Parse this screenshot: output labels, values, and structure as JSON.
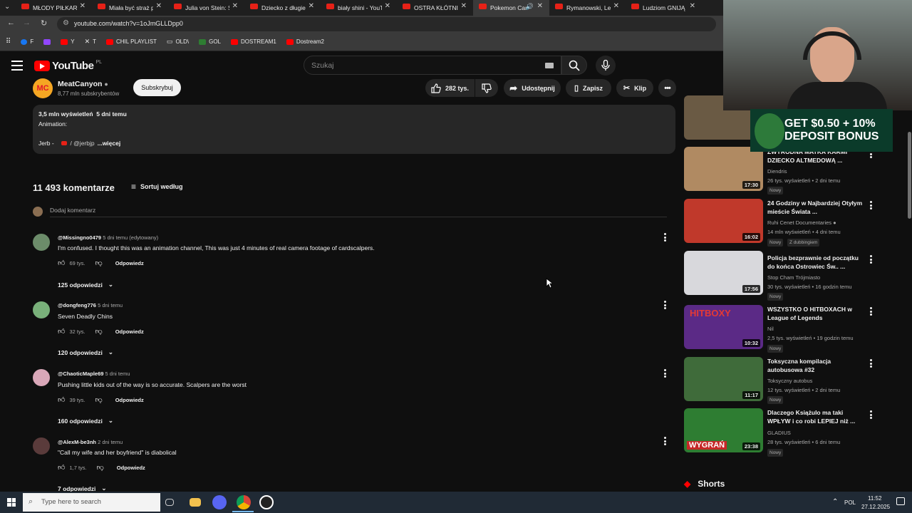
{
  "browser": {
    "tabs": [
      {
        "title": "MŁODY PIŁKARZ",
        "active": false
      },
      {
        "title": "Miała być straż p",
        "active": false
      },
      {
        "title": "Julia von Stein: Św",
        "active": false
      },
      {
        "title": "Dziecko z długiem",
        "active": false
      },
      {
        "title": "biały shini - YouTu",
        "active": false
      },
      {
        "title": "OSTRA KŁÓTNIA",
        "active": false
      },
      {
        "title": "Pokemon Car",
        "active": true
      },
      {
        "title": "Rymanowski, Lew",
        "active": false
      },
      {
        "title": "Ludziom GNIJĄ M",
        "active": false
      }
    ],
    "url": "youtube.com/watch?v=1oJmGLLDpp0",
    "bookmarks": [
      {
        "label": "F",
        "color": "#1877f2"
      },
      {
        "label": "",
        "color": "#9146ff"
      },
      {
        "label": "Y",
        "color": "#ff0000"
      },
      {
        "label": "T",
        "color": "#ffffff"
      },
      {
        "label": "CHIL PLAYLIST",
        "color": "#ff0000"
      },
      {
        "label": "OLD\\",
        "color": "#cccccc"
      },
      {
        "label": "GOL",
        "color": "#2e7d32"
      },
      {
        "label": "DOSTREAM1",
        "color": "#ff0000"
      },
      {
        "label": "Dostream2",
        "color": "#ff0000"
      }
    ]
  },
  "youtube": {
    "logo_text": "YouTube",
    "logo_region": "PL",
    "search_placeholder": "Szukaj",
    "channel": {
      "avatar_text": "MC",
      "name": "MeatCanyon",
      "subs": "8,77 mln subskrybentów"
    },
    "subscribe_label": "Subskrybuj",
    "likes": "282 tys.",
    "share_label": "Udostępnij",
    "save_label": "Zapisz",
    "clip_label": "Klip",
    "description": {
      "stats": "3,5 mln wyświetleń  5 dni temu",
      "line1": "Animation:",
      "line2a": "Jerb - ",
      "line2b": " / @jerbjp",
      "more": "...więcej"
    },
    "comments_header": {
      "count": "11 493 komentarze",
      "sort_label": "Sortuj według",
      "add_placeholder": "Dodaj komentarz"
    },
    "comments": [
      {
        "author": "@Missingno0479",
        "meta": "5 dni temu (edytowany)",
        "text": "I'm confused. I thought this was an animation channel, This was just 4 minutes of real camera footage of cardscalpers.",
        "likes": "69 tys.",
        "reply_label": "Odpowiedz",
        "replies": "125 odpowiedzi",
        "avatar_color": "#6c8c6a"
      },
      {
        "author": "@dongfeng776",
        "meta": "5 dni temu",
        "text": "Seven Deadly Chins",
        "likes": "32 tys.",
        "reply_label": "Odpowiedz",
        "replies": "120 odpowiedzi",
        "avatar_color": "#79b07a"
      },
      {
        "author": "@ChaoticMaple69",
        "meta": "5 dni temu",
        "text": "Pushing little kids out of the way is so accurate. Scalpers are the worst",
        "likes": "39 tys.",
        "reply_label": "Odpowiedz",
        "replies": "160 odpowiedzi",
        "avatar_color": "#d9a7b8"
      },
      {
        "author": "@AlexM-be3nh",
        "meta": "2 dni temu",
        "text": "\"Call my wife and her boyfriend\" is diabolical",
        "likes": "1,7 tys.",
        "reply_label": "Odpowiedz",
        "replies": "7 odpowiedzi",
        "avatar_color": "#5a3b3b"
      }
    ],
    "sidebar": [
      {
        "title": "ZWYRODNA MATKA KARMI DZIECKO ALTMEDOWĄ ...",
        "channel": "Diendris",
        "meta": "26 tys. wyświetleń • 2 dni temu",
        "badge": "Nowy",
        "duration": "17:30",
        "thumb_color": "#b08a62"
      },
      {
        "title": "24 Godziny w Najbardziej Otyłym mieście Świata ...",
        "channel": "Ruhi Cenet Documentaries",
        "meta": "14 mln wyświetleń • 4 dni temu",
        "badge": "Nowy",
        "extra_badge": "Z dubbingiem",
        "duration": "16:02",
        "thumb_color": "#c0392b"
      },
      {
        "title": "Policja bezprawnie od początku do końca Ostrowiec Św.. ...",
        "channel": "Stop Cham Trójmiasto",
        "meta": "30 tys. wyświetleń • 16 godzin temu",
        "badge": "Nowy",
        "duration": "17:56",
        "thumb_color": "#d8d8dc"
      },
      {
        "title": "WSZYSTKO O HITBOXACH w League of Legends",
        "channel": "Nil",
        "meta": "2,5 tys. wyświetleń • 19 godzin temu",
        "badge": "Nowy",
        "duration": "10:32",
        "thumb_color": "#5b2a86",
        "thumb_text": "HITBOXY"
      },
      {
        "title": "Toksyczna kompilacja autobusowa #32",
        "channel": "Toksyczny autobus",
        "meta": "12 tys. wyświetleń • 2 dni temu",
        "badge": "Nowy",
        "duration": "11:17",
        "thumb_color": "#3f6b3a"
      },
      {
        "title": "Dlaczego Książulo ma taki WPŁYW i co robi LEPIEJ niż ...",
        "channel": "GLADIUS",
        "meta": "28 tys. wyświetleń • 6 dni temu",
        "badge": "Nowy",
        "duration": "23:38",
        "thumb_color": "#2e7d32",
        "thumb_text": "WYGRAŃ"
      }
    ],
    "shorts_label": "Shorts"
  },
  "overlay": {
    "promo_line1": "GET $0.50 + 10%",
    "promo_line2": "DEPOSIT BONUS"
  },
  "taskbar": {
    "search_placeholder": "Type here to search",
    "lang": "POL",
    "time": "11:52",
    "date": "27.12.2025"
  }
}
